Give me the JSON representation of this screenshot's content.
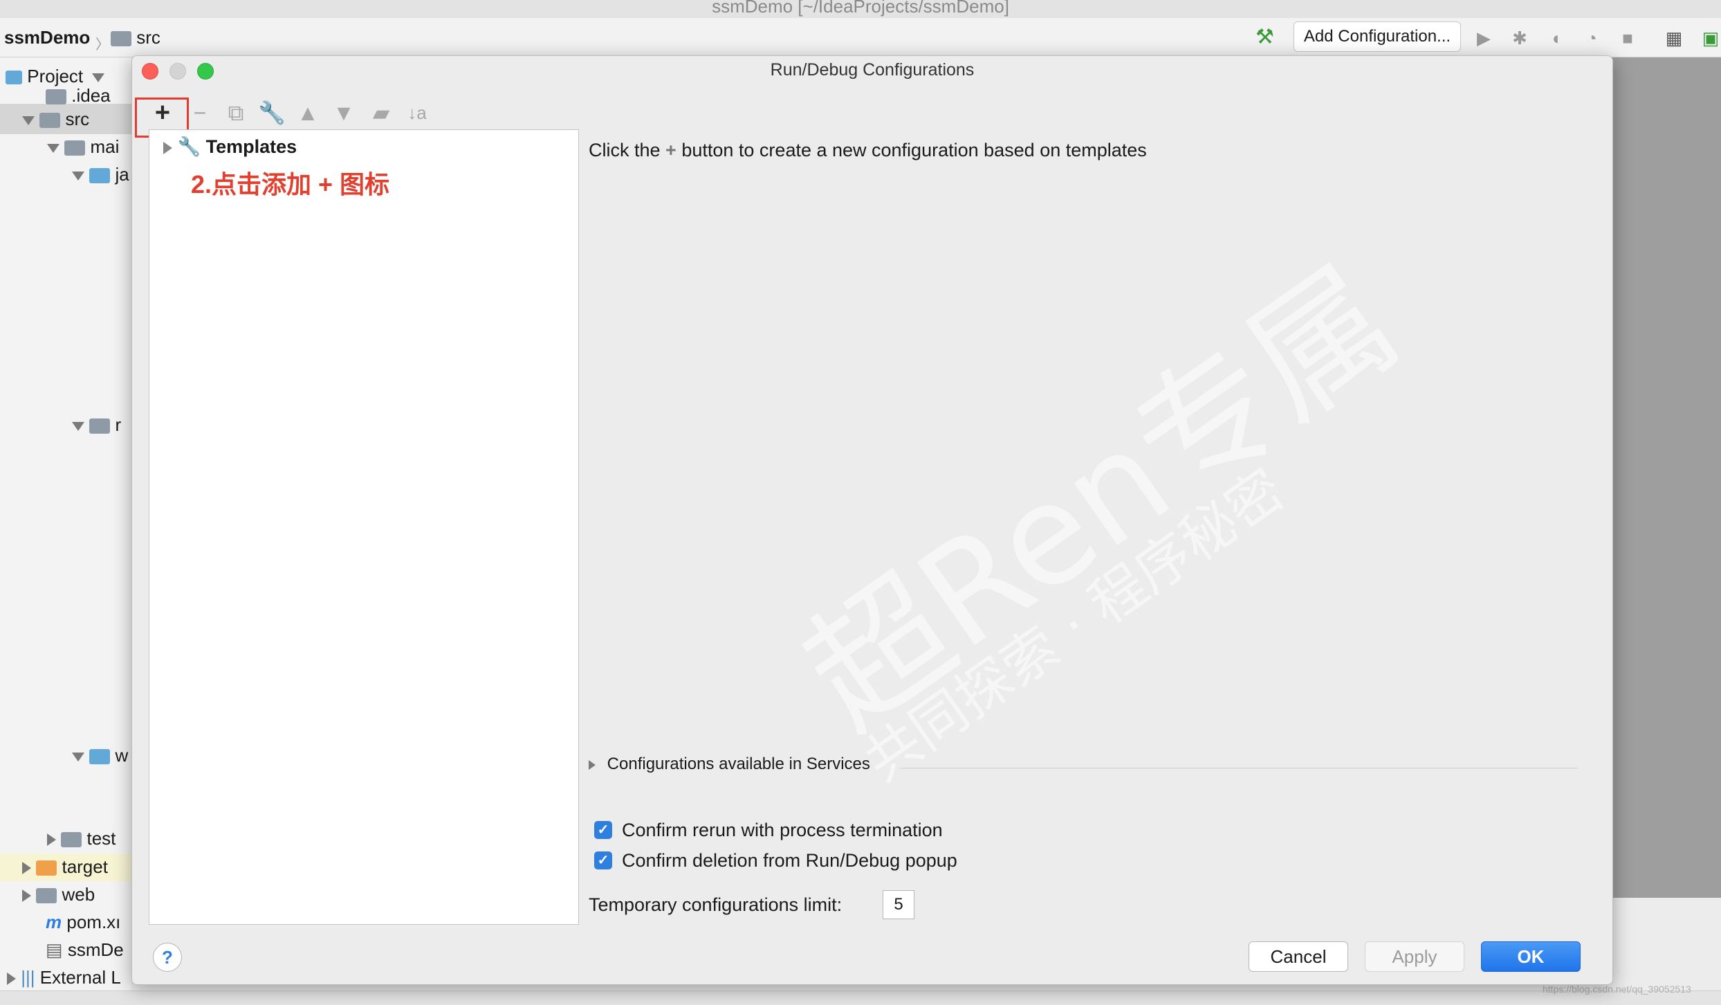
{
  "window": {
    "title": "ssmDemo [~/IdeaProjects/ssmDemo]"
  },
  "navbar": {
    "project": "ssmDemo",
    "folder": "src",
    "add_configuration": "Add Configuration..."
  },
  "project_panel": {
    "header": "Project",
    "items": [
      {
        "label": ".idea"
      },
      {
        "label": "src"
      },
      {
        "label": "mai"
      },
      {
        "label": "ja"
      },
      {
        "label": "r"
      },
      {
        "label": "w"
      },
      {
        "label": "test"
      },
      {
        "label": "target"
      },
      {
        "label": "web"
      },
      {
        "label": "pom.xı"
      },
      {
        "label": "ssmDe"
      },
      {
        "label": "External L"
      }
    ]
  },
  "dialog": {
    "title": "Run/Debug Configurations",
    "toolbar": {
      "add": "+",
      "remove": "−"
    },
    "tree": {
      "templates": "Templates"
    },
    "annotation": "2.点击添加 + 图标",
    "hint_prefix": "Click the",
    "hint_plus": "+",
    "hint_suffix": "button to create a new configuration based on templates",
    "services": "Configurations available in Services",
    "checkboxes": [
      {
        "label": "Confirm rerun with process termination",
        "checked": true
      },
      {
        "label": "Confirm deletion from Run/Debug popup",
        "checked": true
      }
    ],
    "temp_limit_label": "Temporary configurations limit:",
    "temp_limit_value": "5",
    "help": "?",
    "buttons": {
      "cancel": "Cancel",
      "apply": "Apply",
      "ok": "OK"
    }
  },
  "watermark": {
    "text": "超Ren专属",
    "subtext": "共同探索 · 程序秘密"
  },
  "status": {
    "url": "https://blog.csdn.net/qq_39052513"
  },
  "colors": {
    "accent_blue": "#2f7fe0",
    "annotation_red": "#e0402f",
    "ok_button": "#1f74ea"
  }
}
